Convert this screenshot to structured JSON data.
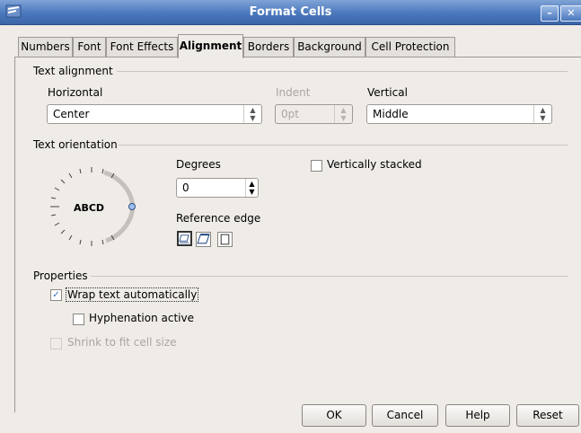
{
  "window": {
    "title": "Format Cells"
  },
  "tabs": [
    "Numbers",
    "Font",
    "Font Effects",
    "Alignment",
    "Borders",
    "Background",
    "Cell Protection"
  ],
  "text_alignment": {
    "section": "Text alignment",
    "horizontal_label": "Horizontal",
    "horizontal_value": "Center",
    "indent_label": "Indent",
    "indent_value": "0pt",
    "vertical_label": "Vertical",
    "vertical_value": "Middle"
  },
  "text_orientation": {
    "section": "Text orientation",
    "dial_text": "ABCD",
    "degrees_label": "Degrees",
    "degrees_value": "0",
    "vertically_stacked_label": "Vertically stacked",
    "reference_edge_label": "Reference edge"
  },
  "properties": {
    "section": "Properties",
    "wrap_label": "Wrap text automatically",
    "wrap_checked": true,
    "hyphenation_label": "Hyphenation active",
    "shrink_label": "Shrink to fit cell size"
  },
  "buttons": {
    "ok": "OK",
    "cancel": "Cancel",
    "help": "Help",
    "reset": "Reset"
  },
  "colors": {
    "titlebar": "#4a78bd",
    "dialog_bg": "#efebe7",
    "check": "#3b6cc0",
    "dial_handle": "#4a78bd"
  }
}
